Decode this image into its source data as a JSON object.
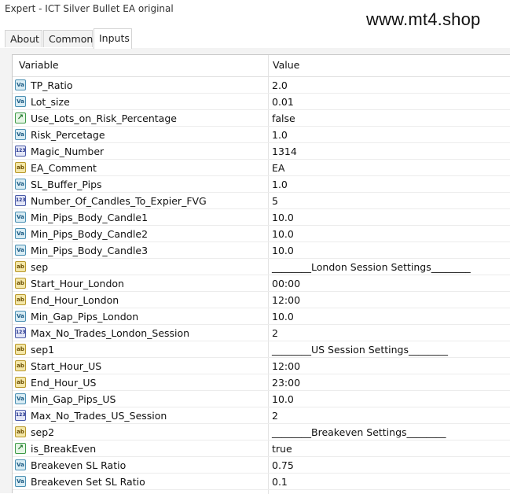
{
  "window": {
    "title": "Expert - ICT Silver Bullet EA original"
  },
  "watermark": "www.mt4.shop",
  "tabs": [
    {
      "label": "About",
      "active": false
    },
    {
      "label": "Common",
      "active": false
    },
    {
      "label": "Inputs",
      "active": true
    }
  ],
  "grid": {
    "headers": {
      "variable": "Variable",
      "value": "Value"
    },
    "rows": [
      {
        "icon": "va",
        "name": "TP_Ratio",
        "value": "2.0"
      },
      {
        "icon": "va",
        "name": "Lot_size",
        "value": "0.01"
      },
      {
        "icon": "bool",
        "name": "Use_Lots_on_Risk_Percentage",
        "value": "false"
      },
      {
        "icon": "va",
        "name": "Risk_Percetage",
        "value": "1.0"
      },
      {
        "icon": "n123",
        "name": "Magic_Number",
        "value": "1314"
      },
      {
        "icon": "ab",
        "name": "EA_Comment",
        "value": "EA"
      },
      {
        "icon": "va",
        "name": "SL_Buffer_Pips",
        "value": "1.0"
      },
      {
        "icon": "n123",
        "name": "Number_Of_Candles_To_Expier_FVG",
        "value": "5"
      },
      {
        "icon": "va",
        "name": "Min_Pips_Body_Candle1",
        "value": "10.0"
      },
      {
        "icon": "va",
        "name": "Min_Pips_Body_Candle2",
        "value": "10.0"
      },
      {
        "icon": "va",
        "name": "Min_Pips_Body_Candle3",
        "value": "10.0"
      },
      {
        "icon": "ab",
        "name": "sep",
        "value": "________London Session Settings________"
      },
      {
        "icon": "ab",
        "name": "Start_Hour_London",
        "value": "00:00"
      },
      {
        "icon": "ab",
        "name": "End_Hour_London",
        "value": "12:00"
      },
      {
        "icon": "va",
        "name": "Min_Gap_Pips_London",
        "value": "10.0"
      },
      {
        "icon": "n123",
        "name": "Max_No_Trades_London_Session",
        "value": "2"
      },
      {
        "icon": "ab",
        "name": "sep1",
        "value": "________US Session Settings________"
      },
      {
        "icon": "ab",
        "name": "Start_Hour_US",
        "value": "12:00"
      },
      {
        "icon": "ab",
        "name": "End_Hour_US",
        "value": "23:00"
      },
      {
        "icon": "va",
        "name": "Min_Gap_Pips_US",
        "value": "10.0"
      },
      {
        "icon": "n123",
        "name": "Max_No_Trades_US_Session",
        "value": "2"
      },
      {
        "icon": "ab",
        "name": "sep2",
        "value": "________Breakeven Settings________"
      },
      {
        "icon": "bool",
        "name": "is_BreakEven",
        "value": "true"
      },
      {
        "icon": "va",
        "name": "Breakeven SL Ratio",
        "value": "0.75"
      },
      {
        "icon": "va",
        "name": "Breakeven Set SL Ratio",
        "value": "0.1"
      }
    ]
  },
  "icon_glyphs": {
    "va": "Va",
    "ab": "ab",
    "n123": "123",
    "bool": "↗"
  },
  "icon_names": {
    "va": "double-value-icon",
    "ab": "string-value-icon",
    "n123": "integer-value-icon",
    "bool": "bool-value-icon"
  }
}
